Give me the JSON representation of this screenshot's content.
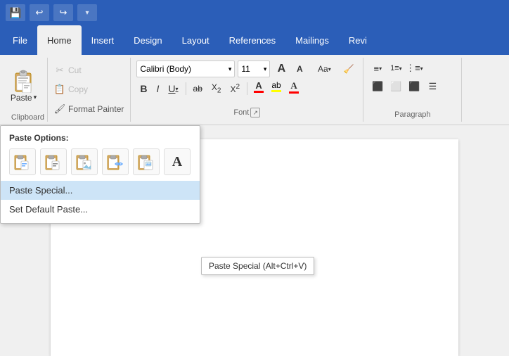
{
  "titlebar": {
    "save_icon": "💾",
    "undo_icon": "↩",
    "redo_icon": "↪",
    "dropdown_icon": "▾"
  },
  "menubar": {
    "items": [
      {
        "label": "File",
        "active": false
      },
      {
        "label": "Home",
        "active": true
      },
      {
        "label": "Insert",
        "active": false
      },
      {
        "label": "Design",
        "active": false
      },
      {
        "label": "Layout",
        "active": false
      },
      {
        "label": "References",
        "active": false
      },
      {
        "label": "Mailings",
        "active": false
      },
      {
        "label": "Revi",
        "active": false
      }
    ]
  },
  "ribbon": {
    "paste_label": "Paste",
    "cut_label": "Cut",
    "copy_label": "Copy",
    "format_painter_label": "Format Painter",
    "font_name": "Calibri (Body)",
    "font_size": "11",
    "font_group_label": "Font",
    "paragraph_group_label": "Paragraph",
    "bold": "B",
    "italic": "I",
    "underline": "U",
    "strikethrough": "ab",
    "subscript": "X₂",
    "superscript": "X²",
    "case_label": "Aa",
    "clear_label": "🧹"
  },
  "paste_dropdown": {
    "header": "Paste Options:",
    "icons": [
      "📋",
      "📄",
      "🔗",
      "🔗",
      "🖼",
      "A"
    ],
    "items": [
      {
        "label": "Paste Special...",
        "highlighted": true
      },
      {
        "label": "Set Default Paste..."
      }
    ]
  },
  "tooltip": {
    "text": "Paste Special (Alt+Ctrl+V)"
  },
  "document": {
    "content": ""
  }
}
